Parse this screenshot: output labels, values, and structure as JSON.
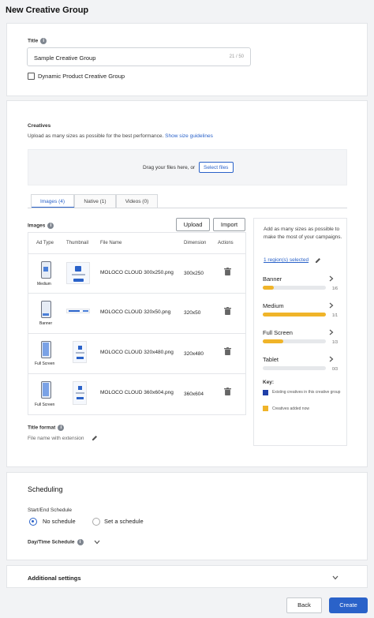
{
  "page_title": "New Creative Group",
  "title_section": {
    "label": "Title",
    "value": "Sample Creative Group",
    "counter": "21 / 50",
    "checkbox_label": "Dynamic Product Creative Group"
  },
  "creatives": {
    "heading": "Creatives",
    "hint": "Upload as many sizes as possible for the best performance.",
    "hint_link": "Show size guidelines",
    "drop_text": "Drag your files here, or",
    "select_files": "Select files",
    "tabs": [
      "Images (4)",
      "Native (1)",
      "Videos (0)"
    ],
    "images_label": "Images",
    "upload": "Upload",
    "import": "Import",
    "columns": [
      "Ad Type",
      "Thumbnail",
      "File Name",
      "Dimension",
      "Actions"
    ],
    "rows": [
      {
        "type": "Medium",
        "file": "MOLOCO CLOUD 300x250.png",
        "dimension": "300x250"
      },
      {
        "type": "Banner",
        "file": "MOLOCO CLOUD 320x50.png",
        "dimension": "320x50"
      },
      {
        "type": "Full Screen",
        "file": "MOLOCO CLOUD 320x480.png",
        "dimension": "320x480"
      },
      {
        "type": "Full Screen",
        "file": "MOLOCO CLOUD 360x604.png",
        "dimension": "360x604"
      }
    ],
    "title_format_label": "Title format",
    "title_format_value": "File name with extension"
  },
  "sidebar": {
    "intro": "Add as many sizes as possible to make the most of your campaigns.",
    "regions": "1 region(s) selected",
    "items": [
      {
        "name": "Banner",
        "count": "1/6",
        "fill": 0.17
      },
      {
        "name": "Medium",
        "count": "1/1",
        "fill": 1.0
      },
      {
        "name": "Full Screen",
        "count": "1/3",
        "fill": 0.33
      },
      {
        "name": "Tablet",
        "count": "0/3",
        "fill": 0.0
      }
    ],
    "key_label": "Key:",
    "key_existing": "Existing creatives in this creative group",
    "key_added": "Creatives added now",
    "colors": {
      "existing": "#1f3fa8",
      "added": "#f0b429"
    }
  },
  "scheduling": {
    "heading": "Scheduling",
    "start_end_label": "Start/End Schedule",
    "option_no": "No schedule",
    "option_set": "Set a schedule",
    "day_time_label": "Day/Time Schedule"
  },
  "additional": {
    "label": "Additional settings"
  },
  "footer": {
    "back": "Back",
    "create": "Create"
  }
}
